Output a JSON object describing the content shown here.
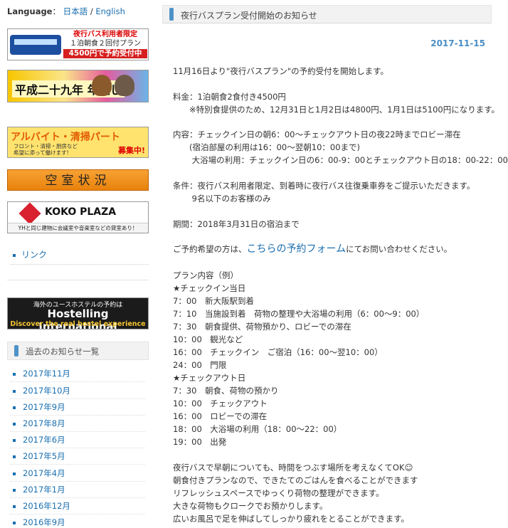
{
  "language": {
    "label": "Language",
    "sep": "：",
    "ja": "日本語",
    "slash": "/",
    "en": "English"
  },
  "banners": {
    "bus": {
      "line1": "夜行バス利用者限定",
      "line2": "１泊朝食２回付プラン",
      "line3": "4500円で予約受付中"
    },
    "newyear": {
      "text": "平成二十九年 年越し"
    },
    "parttime": {
      "title": "アルバイト・清掃パート",
      "sub1": "フロント・清掃・厨房など",
      "sub2": "希望に添って働けます!",
      "badge": "募集中!"
    },
    "vacancy": {
      "text": "空室状況"
    },
    "koko": {
      "title": "KOKO PLAZA",
      "sub": "YHと同じ建物に会議室や音楽室などの貸室あり！"
    },
    "hi": {
      "top": "海外のユースホステルの予約は",
      "main": "Hostelling International",
      "bottom": "Discover the real hostel experience"
    }
  },
  "link_label": "リンク",
  "archive_heading": "過去のお知らせ一覧",
  "archive": [
    "2017年11月",
    "2017年10月",
    "2017年9月",
    "2017年8月",
    "2017年6月",
    "2017年5月",
    "2017年4月",
    "2017年1月",
    "2016年12月",
    "2016年9月"
  ],
  "article": {
    "title": "夜行バスプラン受付開始のお知らせ",
    "date": "2017-11-15",
    "intro": "11月16日より\"夜行バスプラン\"の予約受付を開始します。",
    "fee": "料金：1泊朝食2食付き4500円",
    "fee_note": "　　※特別食提供のため、12月31日と1月2日は4800円、1月1日は5100円になります。",
    "content1": "内容：チェックイン日の朝6：00〜チェックアウト日の夜22時までロビー滞在",
    "content2": "　　(宿泊部屋の利用は16：00〜翌朝10：00まで)",
    "content3": "　　 大浴場の利用：チェックイン日の6：00-9：00とチェックアウト日の18：00-22：00",
    "cond1": "条件：夜行バス利用者限定、到着時に夜行バス往復乗車券をご提示いただきます。",
    "cond2": "　　 9名以下のお客様のみ",
    "period": "期間：2018年3月31日の宿泊まで",
    "reserve_pre": "ご予約希望の方は、",
    "reserve_link": "こちらの予約フォーム",
    "reserve_post": "にてお問い合わせください。",
    "plan_heading": "プラン内容（例）",
    "plan": [
      "★チェックイン当日",
      "7：00　新大阪駅到着",
      "7：10　当施設到着　荷物の整理や大浴場の利用（6：00〜9：00）",
      "7：30　朝食提供、荷物預かり、ロビーでの滞在",
      "10：00　観光など",
      "16：00　チェックイン　ご宿泊（16：00〜翌10：00）",
      "24：00　門限",
      "★チェックアウト日",
      "7：30　朝食、荷物の預かり",
      "10：00　チェックアウト",
      "16：00　ロビーでの滞在",
      "18：00　大浴場の利用（18：00〜22：00）",
      "19：00　出発"
    ],
    "closing": [
      "夜行バスで早朝についても、時間をつぶす場所を考えなくてOK☺",
      "朝食付きプランなので、できたてのごはんを食べることができます",
      "リフレッシュスペースでゆっくり荷物の整理ができます。",
      "大きな荷物もクロークでお預かりします。",
      "広いお風呂で足を伸ばしてしっかり疲れをとることができます。"
    ]
  },
  "colors": {
    "link": "#1a6fb0",
    "date": "#4a8ec4",
    "accent": "#4e92c8"
  }
}
